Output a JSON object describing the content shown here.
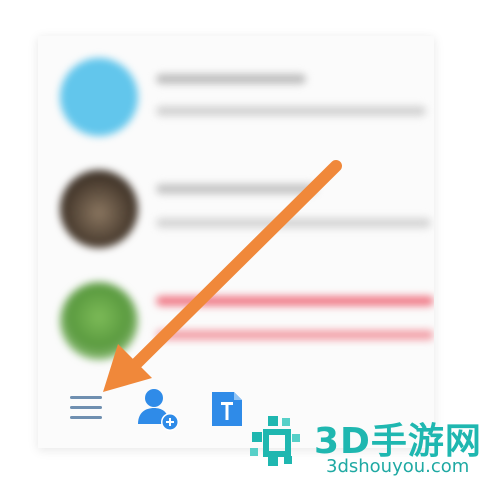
{
  "contacts": [
    {
      "avatar_color": "#62c6ec",
      "name_color": "#bdbdbd",
      "sub_color": "#d2d2d2"
    },
    {
      "avatar_color": "#5a4a3a",
      "name_color": "#c4c4c4",
      "sub_color": "#d5d5d5"
    },
    {
      "avatar_color": "#6aa84f",
      "name_color": "#f07b88",
      "sub_color": "#f2a0a8"
    }
  ],
  "toolbar": {
    "menu_icon": "hamburger-menu-icon",
    "add_user_icon": "add-contact-icon",
    "doc_icon": "document-icon",
    "icon_color": "#2f8be8"
  },
  "annotation": {
    "arrow_color": "#f0883a"
  },
  "watermark": {
    "title": "3D手游网",
    "url": "3dshouyou.com",
    "color": "#1fb7b0"
  }
}
